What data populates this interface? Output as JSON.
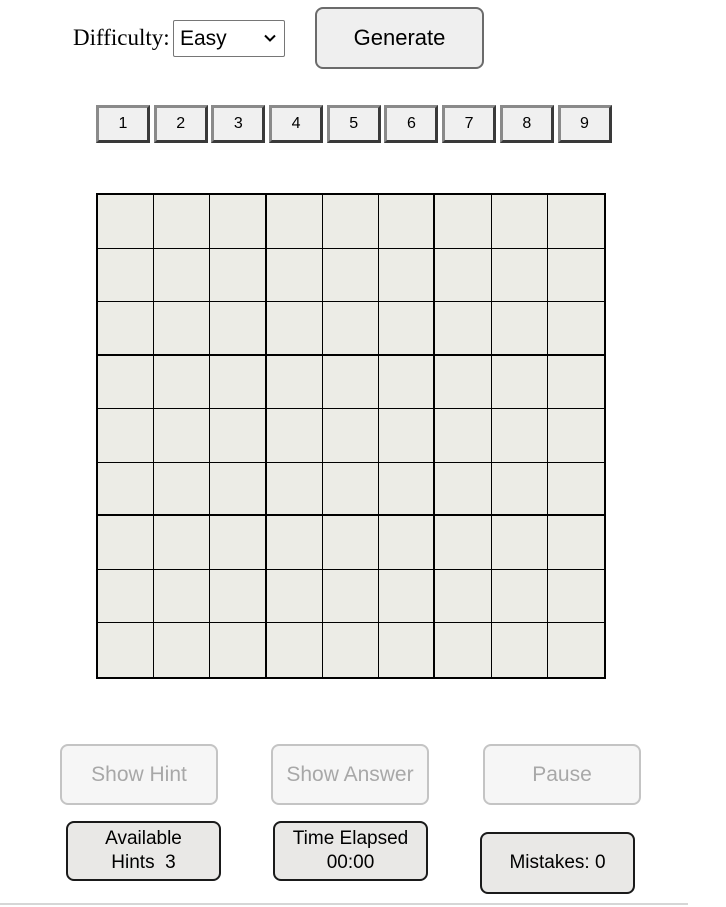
{
  "difficulty": {
    "label": "Difficulty:",
    "selected": "Easy",
    "chevron_icon": "chevron-down-icon"
  },
  "generate_label": "Generate",
  "numpad": [
    "1",
    "2",
    "3",
    "4",
    "5",
    "6",
    "7",
    "8",
    "9"
  ],
  "board": {
    "size": 9,
    "cells": [
      [
        "",
        "",
        "",
        "",
        "",
        "",
        "",
        "",
        ""
      ],
      [
        "",
        "",
        "",
        "",
        "",
        "",
        "",
        "",
        ""
      ],
      [
        "",
        "",
        "",
        "",
        "",
        "",
        "",
        "",
        ""
      ],
      [
        "",
        "",
        "",
        "",
        "",
        "",
        "",
        "",
        ""
      ],
      [
        "",
        "",
        "",
        "",
        "",
        "",
        "",
        "",
        ""
      ],
      [
        "",
        "",
        "",
        "",
        "",
        "",
        "",
        "",
        ""
      ],
      [
        "",
        "",
        "",
        "",
        "",
        "",
        "",
        "",
        ""
      ],
      [
        "",
        "",
        "",
        "",
        "",
        "",
        "",
        "",
        ""
      ],
      [
        "",
        "",
        "",
        "",
        "",
        "",
        "",
        "",
        ""
      ]
    ],
    "cell_color": "#ecece6"
  },
  "controls": {
    "hint_label": "Show Hint",
    "answer_label": "Show Answer",
    "pause_label": "Pause"
  },
  "stats": {
    "hints_line1": "Available",
    "hints_line2": "Hints  3",
    "time_line1": "Time Elapsed",
    "time_line2": "00:00",
    "mistakes": "Mistakes: 0"
  }
}
